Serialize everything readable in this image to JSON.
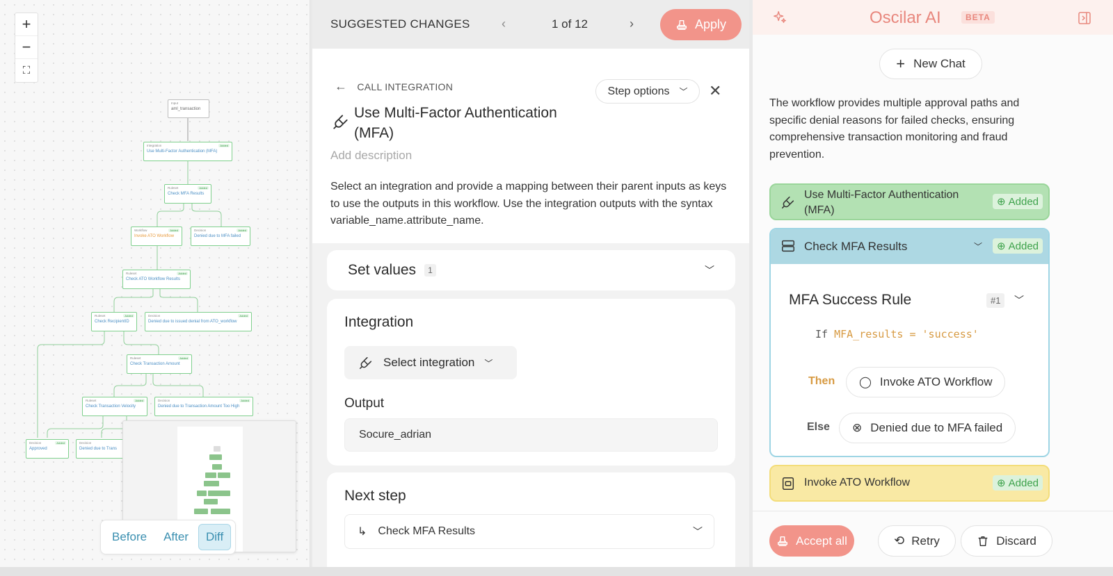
{
  "canvas": {
    "zoom_in": "+",
    "zoom_out": "−",
    "fit": "⛶",
    "nodes": [
      {
        "kind": "Input",
        "title": "aml_transaction",
        "badge": ""
      },
      {
        "kind": "Integration",
        "title": "Use Multi-Factor Authentication (MFA)",
        "badge": "Added"
      },
      {
        "kind": "Ruleset",
        "title": "Check MFA Results",
        "badge": "Added"
      },
      {
        "kind": "Workflow",
        "title": "Invoke ATO Workflow",
        "badge": "Added"
      },
      {
        "kind": "Decision",
        "title": "Denied due to MFA failed",
        "badge": "Added"
      },
      {
        "kind": "Ruleset",
        "title": "Check ATO Workflow Results",
        "badge": "Added"
      },
      {
        "kind": "Ruleset",
        "title": "Check RecipientID",
        "badge": "Added"
      },
      {
        "kind": "Decision",
        "title": "Denied due to issued denial from ATO_workflow",
        "badge": "Added"
      },
      {
        "kind": "Ruleset",
        "title": "Check Transaction Amount",
        "badge": "Added"
      },
      {
        "kind": "Ruleset",
        "title": "Check Transaction Velocity",
        "badge": "Added"
      },
      {
        "kind": "Decision",
        "title": "Denied due to Transaction Amount Too High",
        "badge": "Added"
      },
      {
        "kind": "Decision",
        "title": "Approved",
        "badge": "Added"
      },
      {
        "kind": "Decision",
        "title": "Denied due to Trans",
        "badge": ""
      }
    ],
    "view_toggle": [
      "Before",
      "After",
      "Diff"
    ],
    "active_view": "Diff"
  },
  "changes": {
    "header_title": "SUGGESTED CHANGES",
    "prev": "‹",
    "counter": "1 of 12",
    "next": "›",
    "apply_label": "Apply",
    "back_label": "CALL INTEGRATION",
    "step_options_label": "Step options",
    "step_title": "Use Multi-Factor Authentication (MFA)",
    "add_description": "Add description",
    "description": "Select an integration and provide a mapping between their parent inputs as keys to use the outputs in this workflow. Use the integration outputs with the syntax variable_name.attribute_name.",
    "set_values_label": "Set values",
    "set_values_count": "1",
    "integration_label": "Integration",
    "select_integration_label": "Select integration",
    "output_label": "Output",
    "output_value": "Socure_adrian",
    "next_step_label": "Next step",
    "next_step_value": "Check MFA Results"
  },
  "ai": {
    "title": "Oscilar AI",
    "beta": "BETA",
    "new_chat": "New Chat",
    "message": "The workflow provides multiple approval paths and specific denial reasons for failed checks, ensuring comprehensive transaction monitoring and fraud prevention.",
    "added_label": "Added",
    "items": [
      {
        "label": "Use Multi-Factor Authentication (MFA)",
        "color": "#b3e1b3"
      },
      {
        "label": "Check MFA Results",
        "color": "#add8e3"
      },
      {
        "label": "Invoke ATO Workflow",
        "color": "#f9e9a4"
      }
    ],
    "rule": {
      "title": "MFA Success Rule",
      "number": "#1",
      "if_keyword": "If",
      "condition": "MFA_results = 'success'",
      "then_label": "Then",
      "then_value": "Invoke ATO Workflow",
      "else_label": "Else",
      "else_value": "Denied due to MFA failed"
    },
    "accept_all": "Accept all",
    "retry": "Retry",
    "discard": "Discard"
  },
  "colors": {
    "accent": "#f2948a",
    "added_green": "#3ea24c",
    "node_border": "#7fd08d"
  }
}
